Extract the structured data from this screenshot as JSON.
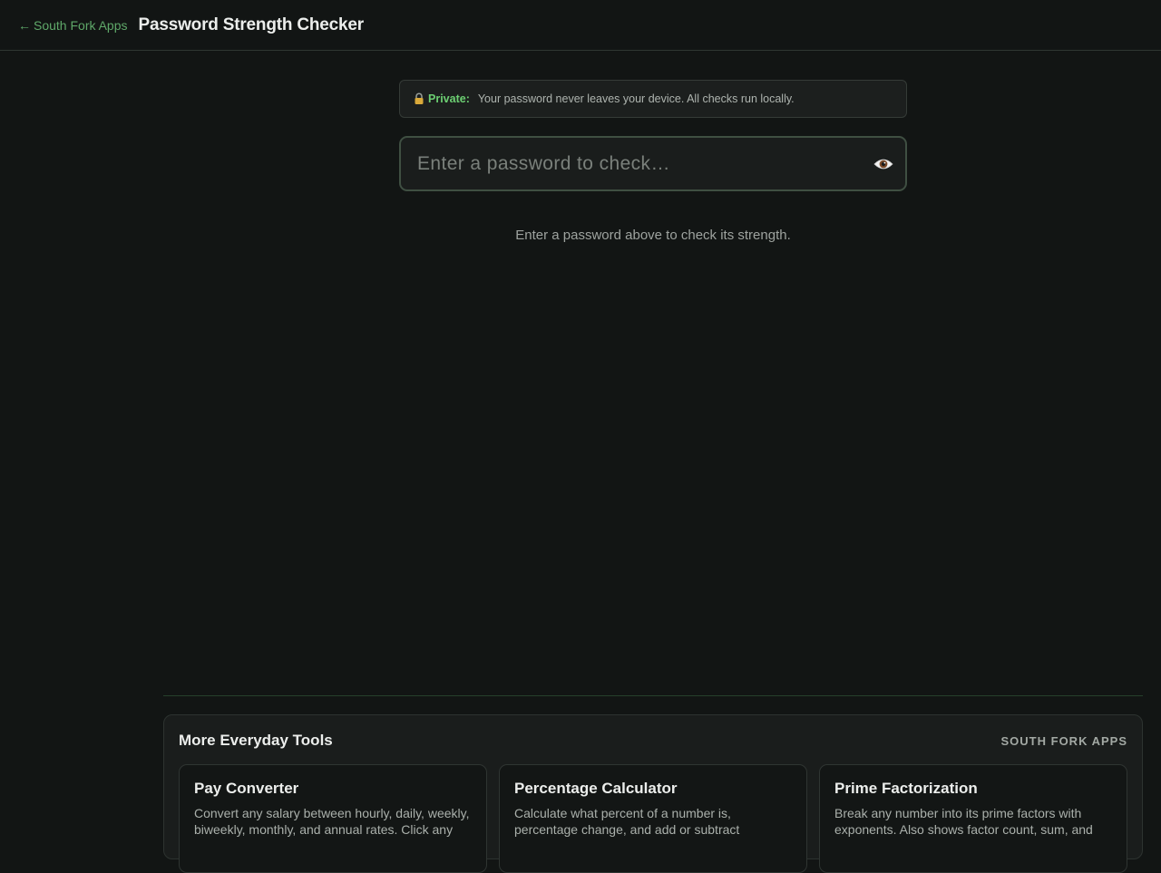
{
  "header": {
    "back_arrow": "←",
    "back_label": "South Fork Apps",
    "title": "Password Strength Checker"
  },
  "privacy": {
    "icon": "lock-icon",
    "label": "Private:",
    "text": "Your password never leaves your device. All checks run locally."
  },
  "password": {
    "value": "",
    "placeholder": "Enter a password to check…",
    "toggle_icon": "eye-icon"
  },
  "hint": "Enter a password above to check its strength.",
  "more_tools": {
    "title": "More Everyday Tools",
    "brand": "SOUTH FORK APPS",
    "cards": [
      {
        "name": "Pay Converter",
        "description": "Convert any salary between hourly, daily, weekly, biweekly, monthly, and annual rates. Click any"
      },
      {
        "name": "Percentage Calculator",
        "description": "Calculate what percent of a number is, percentage change, and add or subtract"
      },
      {
        "name": "Prime Factorization",
        "description": "Break any number into its prime factors with exponents. Also shows factor count, sum, and"
      }
    ]
  },
  "colors": {
    "background": "#121514",
    "accent": "#5fa869",
    "private_label": "#6ccf72",
    "panel": "#1a1d1c"
  }
}
